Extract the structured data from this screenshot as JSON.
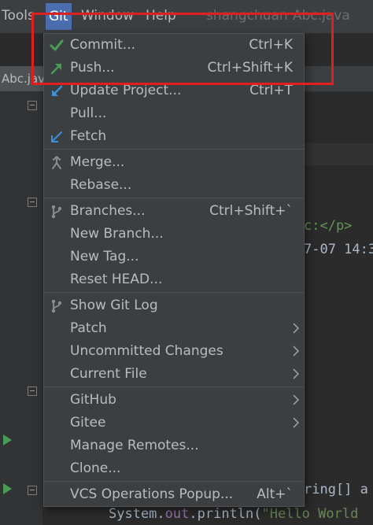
{
  "menubar": {
    "tools": "Tools",
    "git": "Git",
    "window": "Window",
    "help": "Help",
    "project": "shangchuan",
    "file": "Abc.java"
  },
  "tabs": {
    "active": "Abc.jav"
  },
  "code": {
    "line_p": "c:</p>",
    "line_date": "7-07 14:3",
    "line_main_tail": "ring[] a",
    "line_println_obj": "System.",
    "line_println_field": "out",
    "line_println_mid": ".println(",
    "line_println_str": "\"Hello World"
  },
  "git_menu": {
    "items": [
      {
        "label": "Commit...",
        "shortcut": "Ctrl+K",
        "icon": "check-icon",
        "submenu": false
      },
      {
        "label": "Push...",
        "shortcut": "Ctrl+Shift+K",
        "icon": "push-arrow-icon",
        "submenu": false
      },
      {
        "label": "Update Project...",
        "shortcut": "Ctrl+T",
        "icon": "update-arrow-icon",
        "submenu": false
      },
      {
        "label": "Pull...",
        "shortcut": "",
        "icon": "",
        "submenu": false
      },
      {
        "label": "Fetch",
        "shortcut": "",
        "icon": "fetch-arrow-icon",
        "submenu": false
      },
      {
        "label": "Merge...",
        "shortcut": "",
        "icon": "merge-icon",
        "submenu": false
      },
      {
        "label": "Rebase...",
        "shortcut": "",
        "icon": "",
        "submenu": false
      },
      {
        "label": "Branches...",
        "shortcut": "Ctrl+Shift+`",
        "icon": "branch-icon",
        "submenu": false
      },
      {
        "label": "New Branch...",
        "shortcut": "",
        "icon": "",
        "submenu": false
      },
      {
        "label": "New Tag...",
        "shortcut": "",
        "icon": "",
        "submenu": false
      },
      {
        "label": "Reset HEAD...",
        "shortcut": "",
        "icon": "",
        "submenu": false
      },
      {
        "label": "Show Git Log",
        "shortcut": "",
        "icon": "git-log-icon",
        "submenu": false
      },
      {
        "label": "Patch",
        "shortcut": "",
        "icon": "",
        "submenu": true
      },
      {
        "label": "Uncommitted Changes",
        "shortcut": "",
        "icon": "",
        "submenu": true
      },
      {
        "label": "Current File",
        "shortcut": "",
        "icon": "",
        "submenu": true
      },
      {
        "label": "GitHub",
        "shortcut": "",
        "icon": "",
        "submenu": true
      },
      {
        "label": "Gitee",
        "shortcut": "",
        "icon": "",
        "submenu": true
      },
      {
        "label": "Manage Remotes...",
        "shortcut": "",
        "icon": "",
        "submenu": false
      },
      {
        "label": "Clone...",
        "shortcut": "",
        "icon": "",
        "submenu": false
      },
      {
        "label": "VCS Operations Popup...",
        "shortcut": "Alt+`",
        "icon": "",
        "submenu": false
      }
    ]
  },
  "colors": {
    "menu_bg": "#3c3f41",
    "highlight": "#4b6eaf",
    "annotation": "#e02020",
    "check": "#499c54",
    "arrow_blue": "#3d8fd6"
  }
}
